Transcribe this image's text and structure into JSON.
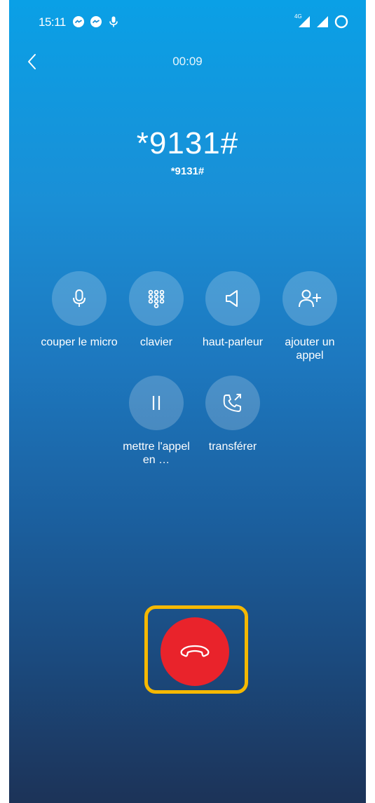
{
  "status_bar": {
    "time": "15:11",
    "network": "4G"
  },
  "header": {
    "timer": "00:09"
  },
  "call": {
    "number": "*9131#",
    "subnumber": "*9131#"
  },
  "actions": {
    "mute": "couper le micro",
    "keypad": "clavier",
    "speaker": "haut-parleur",
    "add_call": "ajouter un appel",
    "hold": "mettre l'appel en …",
    "transfer": "transférer"
  },
  "colors": {
    "end_call": "#e9232b",
    "highlight": "#f5b800",
    "gradient_top": "#0aa0e6",
    "gradient_bottom": "#1c3358"
  }
}
